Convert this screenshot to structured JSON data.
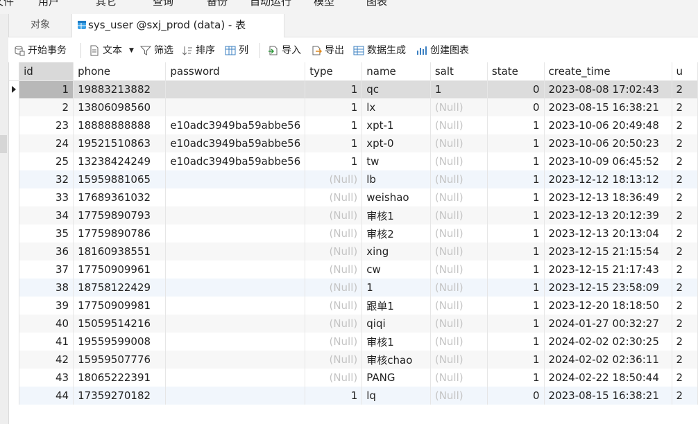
{
  "menubar": {
    "items": [
      "文件",
      "用户",
      "其它",
      "查询",
      "备份",
      "自动运行",
      "模型",
      "图表"
    ]
  },
  "tabs": {
    "objects_label": "对象",
    "table_label": "sys_user @sxj_prod (data) - 表"
  },
  "toolbar": {
    "begin_tx": "开始事务",
    "text": "文本",
    "filter": "筛选",
    "sort": "排序",
    "columns": "列",
    "import": "导入",
    "export": "导出",
    "data_gen": "数据生成",
    "create_chart": "创建图表"
  },
  "columns": [
    "id",
    "phone",
    "password",
    "type",
    "name",
    "salt",
    "state",
    "create_time",
    "u"
  ],
  "rows": [
    [
      "1",
      "19883213882",
      "",
      "1",
      "qc",
      "1",
      "0",
      "2023-08-08 17:02:43",
      "2"
    ],
    [
      "2",
      "13806098560",
      "",
      "1",
      "lx",
      "(Null)",
      "0",
      "2023-08-15 16:38:21",
      "2"
    ],
    [
      "23",
      "18888888888",
      "e10adc3949ba59abbe56",
      "1",
      "xpt-1",
      "(Null)",
      "1",
      "2023-10-06 20:49:48",
      "2"
    ],
    [
      "24",
      "19521510863",
      "e10adc3949ba59abbe56",
      "1",
      "xpt-0",
      "(Null)",
      "1",
      "2023-10-06 20:50:23",
      "2"
    ],
    [
      "25",
      "13238424249",
      "e10adc3949ba59abbe56",
      "1",
      "tw",
      "(Null)",
      "1",
      "2023-10-09 06:45:52",
      "2"
    ],
    [
      "32",
      "15959881065",
      "",
      "(Null)",
      "lb",
      "(Null)",
      "1",
      "2023-12-12 18:13:12",
      "2"
    ],
    [
      "33",
      "17689361032",
      "",
      "(Null)",
      "weishao",
      "(Null)",
      "1",
      "2023-12-13 18:36:49",
      "2"
    ],
    [
      "34",
      "17759890793",
      "",
      "(Null)",
      "审核1",
      "(Null)",
      "1",
      "2023-12-13 20:12:39",
      "2"
    ],
    [
      "35",
      "17759890786",
      "",
      "(Null)",
      "审核2",
      "(Null)",
      "1",
      "2023-12-13 20:13:04",
      "2"
    ],
    [
      "36",
      "18160938551",
      "",
      "(Null)",
      "xing",
      "(Null)",
      "1",
      "2023-12-15 21:15:54",
      "2"
    ],
    [
      "37",
      "17750909961",
      "",
      "(Null)",
      "cw",
      "(Null)",
      "1",
      "2023-12-15 21:17:43",
      "2"
    ],
    [
      "38",
      "18758122429",
      "",
      "(Null)",
      "1",
      "(Null)",
      "1",
      "2023-12-15 23:58:09",
      "2"
    ],
    [
      "39",
      "17750909981",
      "",
      "(Null)",
      "跟单1",
      "(Null)",
      "1",
      "2023-12-20 18:18:50",
      "2"
    ],
    [
      "40",
      "15059514216",
      "",
      "(Null)",
      "qiqi",
      "(Null)",
      "1",
      "2024-01-27 00:32:27",
      "2"
    ],
    [
      "41",
      "19559599008",
      "",
      "(Null)",
      "审核1",
      "(Null)",
      "1",
      "2024-02-02 02:30:25",
      "2"
    ],
    [
      "42",
      "15959507776",
      "",
      "(Null)",
      "审核chao",
      "(Null)",
      "1",
      "2024-02-02 02:36:11",
      "2"
    ],
    [
      "43",
      "18065222391",
      "",
      "(Null)",
      "PANG",
      "(Null)",
      "1",
      "2024-02-22 18:50:44",
      "2"
    ],
    [
      "44",
      "17359270182",
      "",
      "1",
      "lq",
      "(Null)",
      "0",
      "2023-08-15 16:38:21",
      "2"
    ]
  ]
}
